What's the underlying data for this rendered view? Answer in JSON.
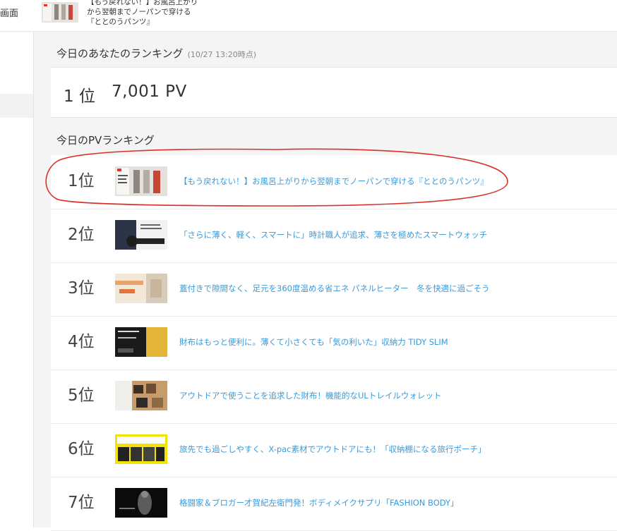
{
  "topbar": {
    "left_label": "画面",
    "item_title": "【もう戻れない！】お風呂上がりから翌朝までノーパンで穿ける『ととのうパンツ』"
  },
  "my_ranking": {
    "heading": "今日のあなたのランキング",
    "timestamp": "(10/27 13:20時点)",
    "rank": "1 位",
    "pv": "7,001 PV"
  },
  "pv_ranking": {
    "heading": "今日のPVランキング",
    "items": [
      {
        "rank": "1位",
        "title": "【もう戻れない！】お風呂上がりから翌朝までノーパンで穿ける『ととのうパンツ』"
      },
      {
        "rank": "2位",
        "title": "「さらに薄く、軽く、スマートに」時計職人が追求、薄さを極めたスマートウォッチ"
      },
      {
        "rank": "3位",
        "title": "蓋付きで隙間なく、足元を360度温める省エネ パネルヒーター　冬を快適に過ごそう"
      },
      {
        "rank": "4位",
        "title": "財布はもっと便利に。薄くて小さくても「気の利いた」収納力 TIDY SLIM"
      },
      {
        "rank": "5位",
        "title": "アウトドアで使うことを追求した財布！機能的なULトレイルウォレット"
      },
      {
        "rank": "6位",
        "title": "旅先でも過ごしやすく、X-pac素材でアウトドアにも！「収納棚になる旅行ポーチ」"
      },
      {
        "rank": "7位",
        "title": "格闘家＆ブロガー才賀紀左衛門発！ボディメイクサプリ「FASHION BODY」"
      }
    ]
  },
  "colors": {
    "link": "#3a9ad9",
    "annotation": "#d9302a",
    "background": "#f4f4f4"
  }
}
